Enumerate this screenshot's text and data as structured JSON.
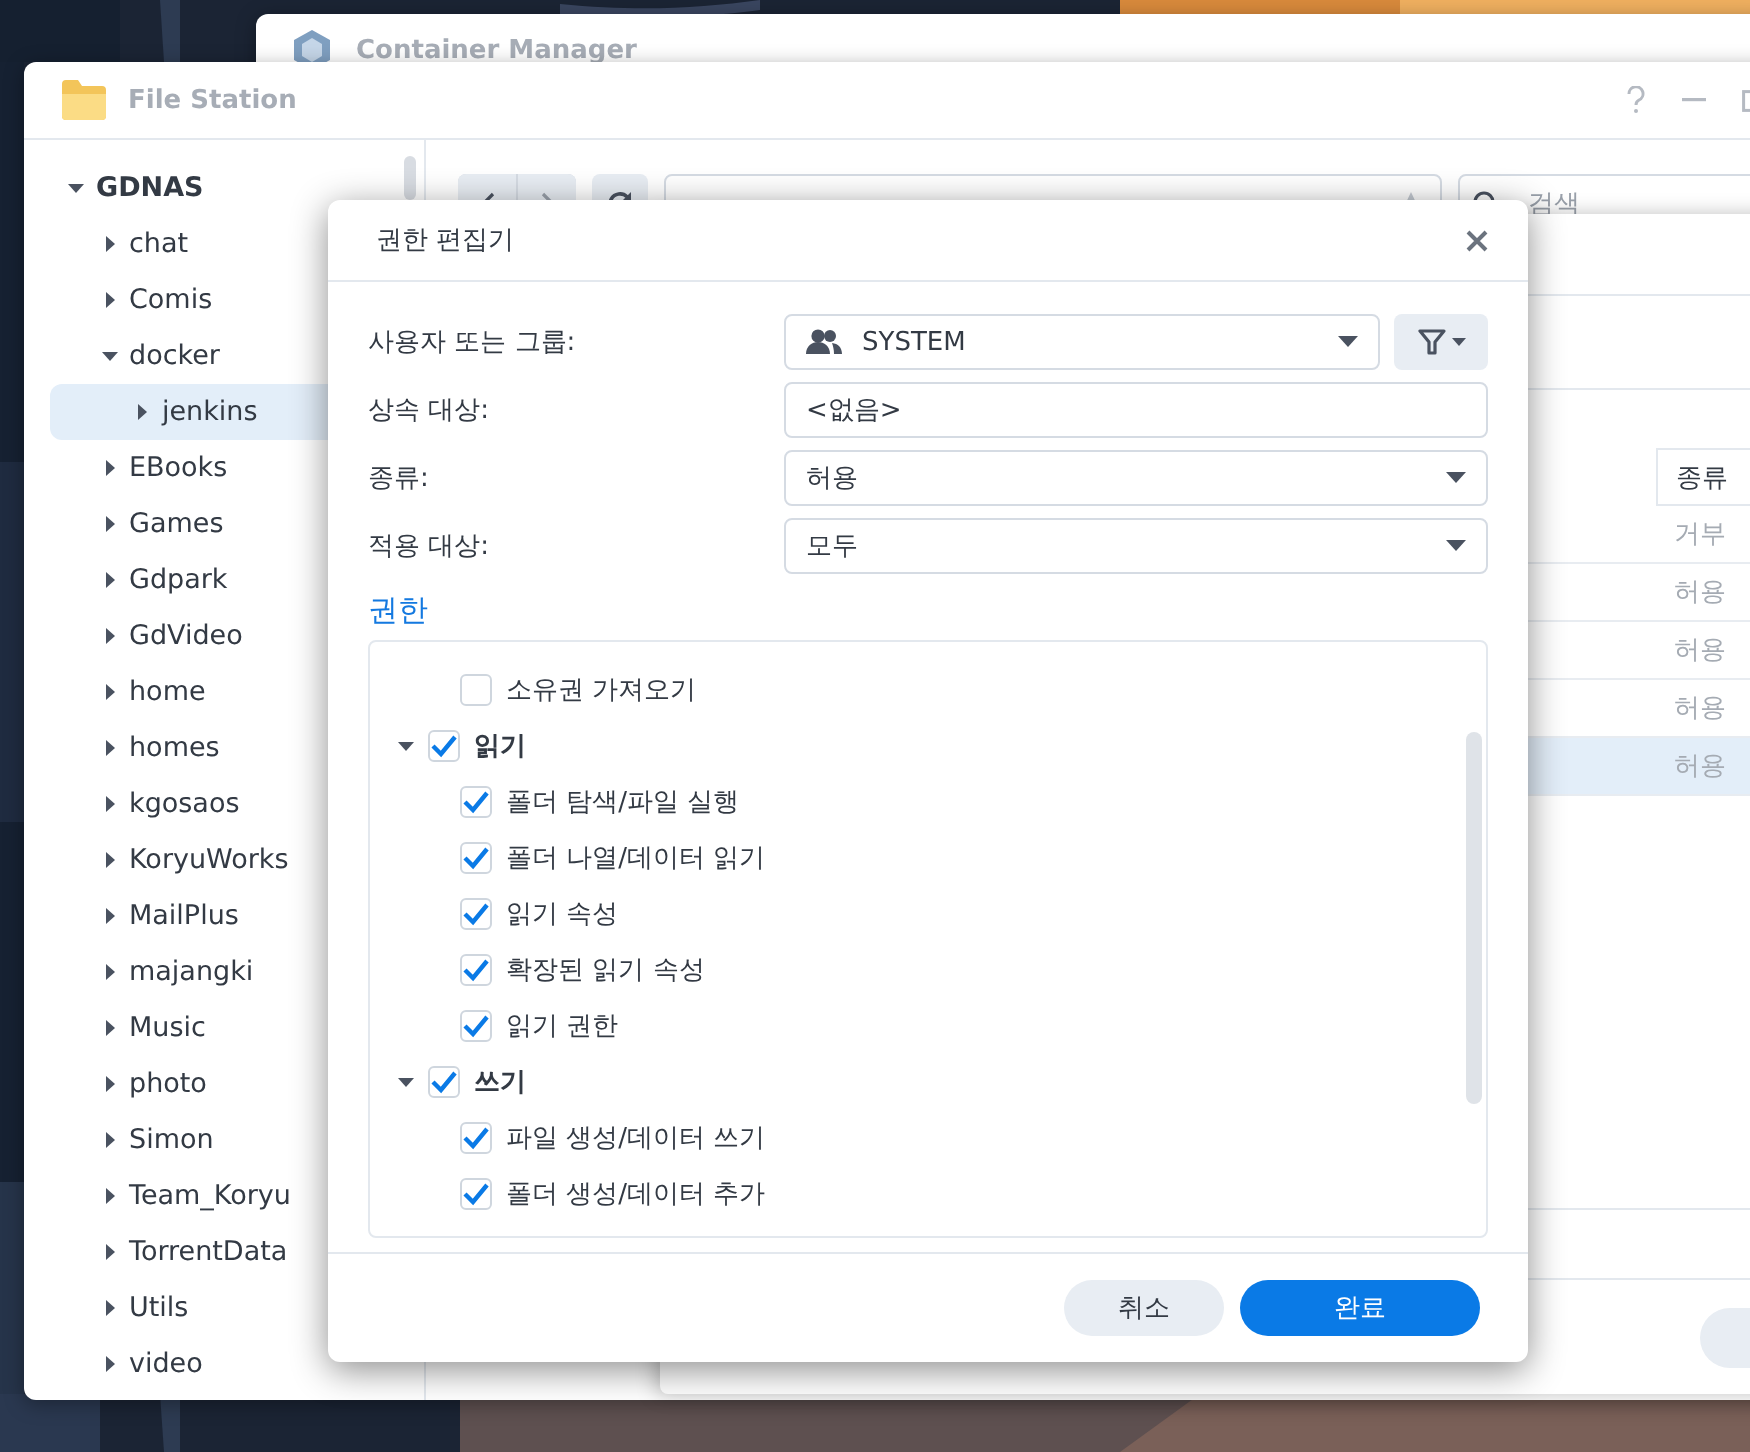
{
  "background_window": {
    "title": "Container Manager"
  },
  "file_station": {
    "title": "File Station",
    "tree": {
      "label": "GDNAS",
      "expanded": true,
      "selected": false,
      "children": [
        {
          "label": "chat",
          "expanded": false,
          "selected": false
        },
        {
          "label": "Comis",
          "expanded": false,
          "selected": false
        },
        {
          "label": "docker",
          "expanded": true,
          "selected": false,
          "children": [
            {
              "label": "jenkins",
              "expanded": false,
              "selected": true
            }
          ]
        },
        {
          "label": "EBooks",
          "expanded": false,
          "selected": false
        },
        {
          "label": "Games",
          "expanded": false,
          "selected": false
        },
        {
          "label": "Gdpark",
          "expanded": false,
          "selected": false
        },
        {
          "label": "GdVideo",
          "expanded": false,
          "selected": false
        },
        {
          "label": "home",
          "expanded": false,
          "selected": false
        },
        {
          "label": "homes",
          "expanded": false,
          "selected": false
        },
        {
          "label": "kgosaos",
          "expanded": false,
          "selected": false
        },
        {
          "label": "KoryuWorks",
          "expanded": false,
          "selected": false
        },
        {
          "label": "MailPlus",
          "expanded": false,
          "selected": false
        },
        {
          "label": "majangki",
          "expanded": false,
          "selected": false
        },
        {
          "label": "Music",
          "expanded": false,
          "selected": false
        },
        {
          "label": "photo",
          "expanded": false,
          "selected": false
        },
        {
          "label": "Simon",
          "expanded": false,
          "selected": false
        },
        {
          "label": "Team_Koryu",
          "expanded": false,
          "selected": false
        },
        {
          "label": "TorrentData",
          "expanded": false,
          "selected": false
        },
        {
          "label": "Utils",
          "expanded": false,
          "selected": false
        },
        {
          "label": "video",
          "expanded": false,
          "selected": false
        }
      ]
    },
    "toolbar": {
      "search": {
        "placeholder": "검색"
      }
    }
  },
  "properties": {
    "table": {
      "columns": [
        "종류"
      ],
      "rows": [
        {
          "type": "거부",
          "selected": false
        },
        {
          "type": "허용",
          "selected": false
        },
        {
          "type": "허용",
          "selected": false
        },
        {
          "type": "허용",
          "selected": false
        },
        {
          "type": "허용",
          "selected": true
        }
      ]
    }
  },
  "dialog": {
    "title": "권한 편집기",
    "fields": [
      {
        "label": "사용자 또는 그룹:",
        "value": "SYSTEM",
        "kind": "user-select"
      },
      {
        "label": "상속 대상:",
        "value": "<없음>",
        "kind": "text"
      },
      {
        "label": "종류:",
        "value": "허용",
        "kind": "select"
      },
      {
        "label": "적용 대상:",
        "value": "모두",
        "kind": "select"
      }
    ],
    "section": "권한",
    "permissions": [
      {
        "label": "소유권 가져오기",
        "checked": false
      },
      {
        "label": "읽기",
        "checked": true,
        "expanded": true,
        "children": [
          {
            "label": "폴더 탐색/파일 실행",
            "checked": true
          },
          {
            "label": "폴더 나열/데이터 읽기",
            "checked": true
          },
          {
            "label": "읽기 속성",
            "checked": true
          },
          {
            "label": "확장된 읽기 속성",
            "checked": true
          },
          {
            "label": "읽기 권한",
            "checked": true
          }
        ]
      },
      {
        "label": "쓰기",
        "checked": true,
        "expanded": true,
        "children": [
          {
            "label": "파일 생성/데이터 쓰기",
            "checked": true
          },
          {
            "label": "폴더 생성/데이터 추가",
            "checked": true
          }
        ]
      }
    ],
    "buttons": [
      {
        "label": "취소",
        "kind": "secondary"
      },
      {
        "label": "완료",
        "kind": "primary"
      }
    ]
  }
}
